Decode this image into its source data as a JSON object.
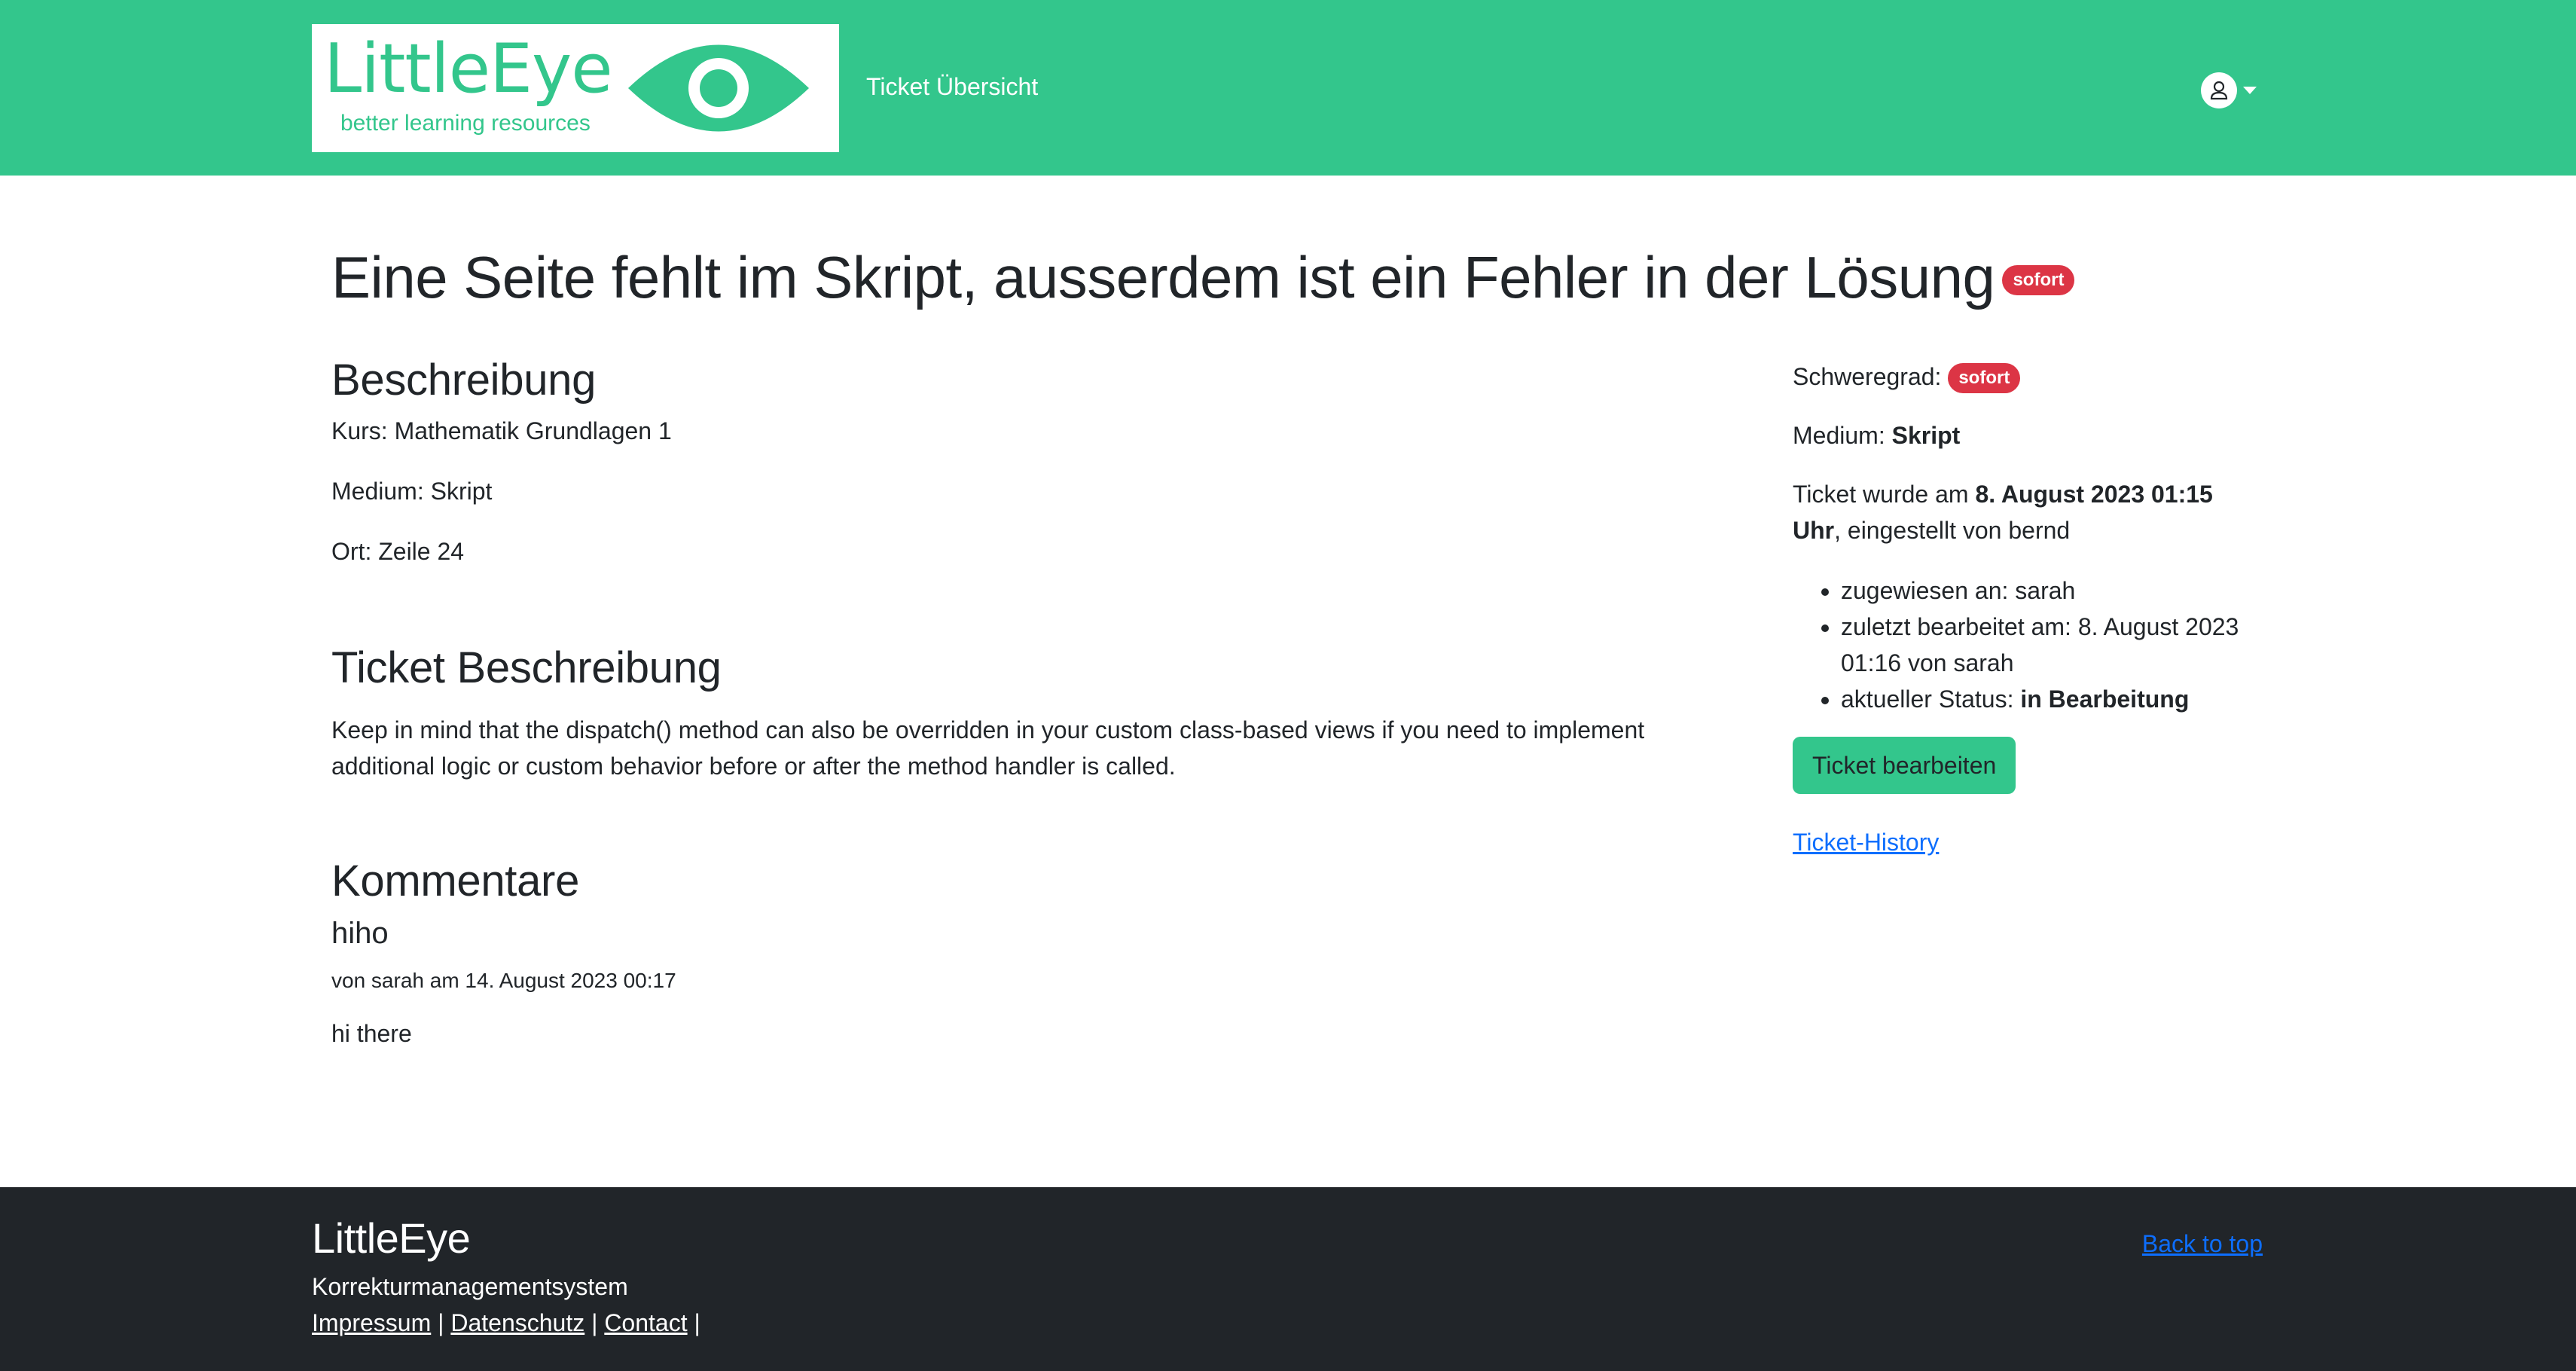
{
  "header": {
    "logo": {
      "word": "LittleEye",
      "tagline": "better learning resources"
    },
    "nav_ticket_overview": "Ticket Übersicht",
    "user_menu_icon": "user-icon"
  },
  "ticket": {
    "title": "Eine Seite fehlt im Skript, ausserdem ist ein Fehler in der Lösung",
    "severity_badge": "sofort"
  },
  "description": {
    "heading": "Beschreibung",
    "course": "Kurs: Mathematik Grundlagen 1",
    "medium": "Medium: Skript",
    "location": "Ort: Zeile 24"
  },
  "ticket_description": {
    "heading": "Ticket Beschreibung",
    "text": "Keep in mind that the dispatch() method can also be overridden in your custom class-based views if you need to implement additional logic or custom behavior before or after the method handler is called."
  },
  "comments": {
    "heading": "Kommentare",
    "items": [
      {
        "title": "hiho",
        "meta": "von sarah am 14. August 2023 00:17",
        "body": "hi there"
      }
    ]
  },
  "sidebar": {
    "severity_label": "Schweregrad:",
    "severity_value": "sofort",
    "medium_label": "Medium:",
    "medium_value": "Skript",
    "created_prefix": "Ticket wurde am",
    "created_date": "8. August 2023 01:15 Uhr",
    "created_suffix": ", eingestellt von bernd",
    "assigned": "zugewiesen an: sarah",
    "last_edited": "zuletzt bearbeitet am: 8. August 2023 01:16 von sarah",
    "status_label": "aktueller Status:",
    "status_value": "in Bearbeitung",
    "edit_button": "Ticket bearbeiten",
    "history_link": "Ticket-History"
  },
  "footer": {
    "title": "LittleEye",
    "subtitle": "Korrekturmanagementsystem",
    "links": [
      "Impressum",
      "Datenschutz",
      "Contact"
    ],
    "separator": "|",
    "back_to_top": "Back to top"
  },
  "colors": {
    "brand_green": "#33c68c",
    "badge_red": "#dc3545",
    "footer_dark": "#212529",
    "link_blue": "#0d6efd"
  }
}
